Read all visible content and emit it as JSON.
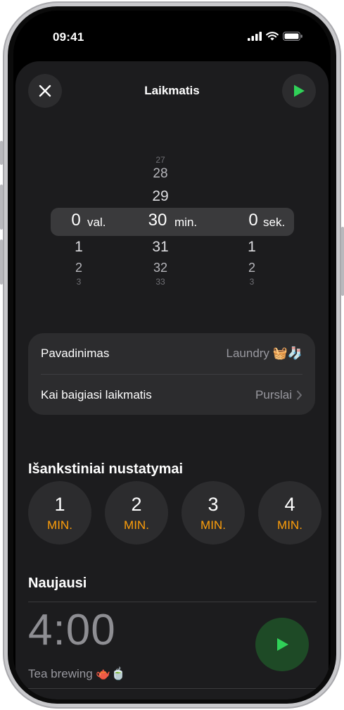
{
  "status": {
    "time": "09:41"
  },
  "sheet": {
    "title": "Laikmatis"
  },
  "picker": {
    "hours": {
      "above": [],
      "selected": "0",
      "below": [
        "1",
        "2",
        "3"
      ],
      "label": "val."
    },
    "minutes": {
      "above": [
        "27",
        "28",
        "29"
      ],
      "selected": "30",
      "below": [
        "31",
        "32",
        "33"
      ],
      "label": "min."
    },
    "seconds": {
      "above": [],
      "selected": "0",
      "below": [
        "1",
        "2",
        "3"
      ],
      "label": "sek."
    }
  },
  "settings": {
    "name_label": "Pavadinimas",
    "name_value": "Laundry 🧺🧦",
    "end_label": "Kai baigiasi laikmatis",
    "end_value": "Purslai"
  },
  "presets": {
    "title": "Išankstiniai nustatymai",
    "items": [
      {
        "num": "1",
        "unit": "MIN."
      },
      {
        "num": "2",
        "unit": "MIN."
      },
      {
        "num": "3",
        "unit": "MIN."
      },
      {
        "num": "4",
        "unit": "MIN."
      }
    ]
  },
  "recents": {
    "title": "Naujausi",
    "items": [
      {
        "time": "4:00",
        "label": "Tea brewing 🫖🍵"
      }
    ]
  },
  "colors": {
    "accent_green": "#30d158",
    "accent_orange": "#ff9f0a"
  },
  "icons": {
    "close": "close-icon",
    "play": "play-icon",
    "chevron": "chevron-right-icon"
  }
}
